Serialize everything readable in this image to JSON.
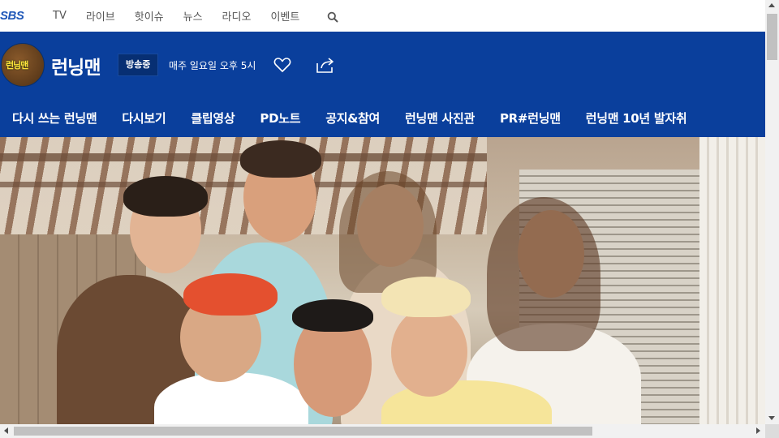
{
  "global_nav": {
    "logo": "SBS",
    "items": [
      "TV",
      "라이브",
      "핫이슈",
      "뉴스",
      "라디오",
      "이벤트"
    ],
    "search_icon": "search-icon"
  },
  "program": {
    "avatar_text": "런닝맨",
    "title": "런닝맨",
    "badge": "방송중",
    "schedule": "매주 일요일 오후 5시",
    "like_icon": "heart-icon",
    "share_icon": "share-icon",
    "menu": [
      "다시 쓰는 런닝맨",
      "다시보기",
      "클립영상",
      "PD노트",
      "공지&참여",
      "런닝맨 사진관",
      "PR#런닝맨",
      "런닝맨 10년 발자취"
    ]
  },
  "colors": {
    "brand_blue": "#0a3f9c",
    "badge_blue": "#072f73",
    "logo_blue": "#1f57b8"
  }
}
